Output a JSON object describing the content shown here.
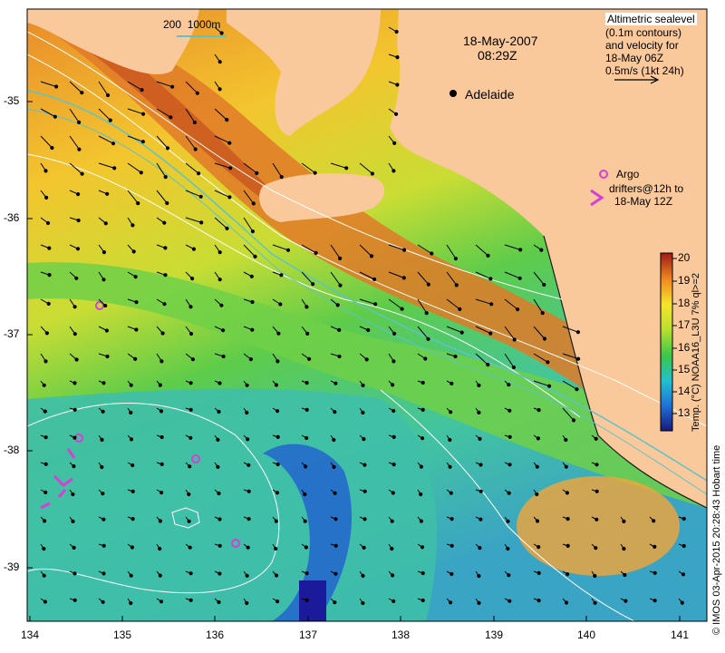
{
  "title_date": "18-May-2007",
  "title_time": "08:29Z",
  "city": "Adelaide",
  "scale_label": "200  1000m",
  "legend_sealevel": [
    "Altimetric sealevel",
    "(0.1m contours)",
    "and velocity for",
    "18-May 06Z",
    "0.5m/s (1kt 24h)"
  ],
  "legend_argo": "Argo",
  "legend_drifters": [
    "drifters@12h to",
    "18-May 12Z"
  ],
  "colorbar_label": "Temp. (°C) NOAA16_L3U 7% ql>=2",
  "credit": "© IMOS 03-Apr-2015 20:28:43 Hobart time",
  "colorbar_ticks": [
    "20",
    "19",
    "18",
    "17",
    "16",
    "15",
    "14",
    "13"
  ],
  "y_ticks": [
    "-35",
    "-36",
    "-37",
    "-38",
    "-39"
  ],
  "x_ticks": [
    "134",
    "135",
    "136",
    "137",
    "138",
    "139",
    "140",
    "141"
  ],
  "colors": {
    "land": "#f9c89b",
    "argo": "#d63fd6",
    "contour": "#ffffff",
    "isobath": "#5ec3c8"
  }
}
